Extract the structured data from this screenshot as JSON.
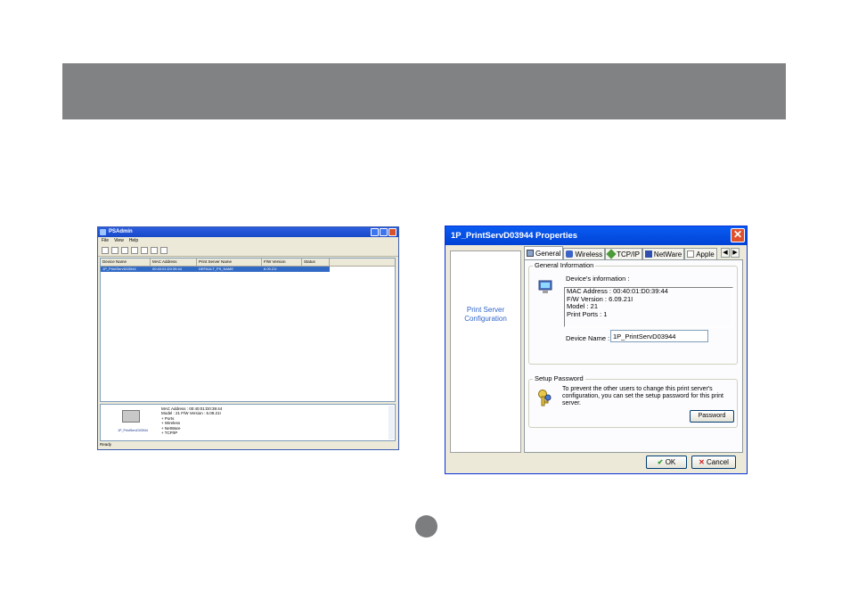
{
  "psadmin": {
    "title": "PSAdmin",
    "menu": [
      "File",
      "View",
      "Help"
    ],
    "toolbar_icons": [
      "new-icon",
      "edit-icon",
      "refresh-icon",
      "printer-icon",
      "properties-icon",
      "settings-icon",
      "help-icon"
    ],
    "columns": [
      "Device Name",
      "MAC Address",
      "Print Server Name",
      "F/W Version",
      "Status"
    ],
    "rows": [
      [
        "1P_PrintServD03944",
        "00:40:01:D0:39:44",
        "DEFAULT_PS_NAME",
        "6.09.21I",
        ""
      ]
    ],
    "detail": {
      "device_name": "1P_PrintServD03944",
      "mac_line": "MAC Address : 00:40:01:D0:39:44",
      "model_line": "Model : 21   F/W Version : 6.09.21I",
      "tree": [
        "Ports",
        "Wireless",
        "NetWare",
        "TCP/IP"
      ]
    },
    "status": "Ready"
  },
  "dialog": {
    "title": "1P_PrintServD03944 Properties",
    "sidebar_label": "Print Server\nConfiguration",
    "tabs": [
      "General",
      "Wireless",
      "TCP/IP",
      "NetWare",
      "Apple"
    ],
    "general": {
      "group_info": "General Information",
      "info_label": "Device's information :",
      "mac": "MAC Address : 00:40:01:D0:39:44",
      "fw": "F/W Version : 6.09.21I",
      "model": "Model : 21",
      "ports": "Print Ports : 1",
      "device_name_label": "Device Name :",
      "device_name_value": "1P_PrintServD03944",
      "group_password": "Setup Password",
      "password_text": "To prevent the other users to change this print server's configuration, you can set the setup password for this print server.",
      "password_button": "Password"
    },
    "ok": "OK",
    "cancel": "Cancel"
  },
  "colors": {
    "banner": "#808283",
    "selection": "#316ac5",
    "xp_title": "#0a5cf2",
    "sidebar_text": "#3066c8"
  }
}
